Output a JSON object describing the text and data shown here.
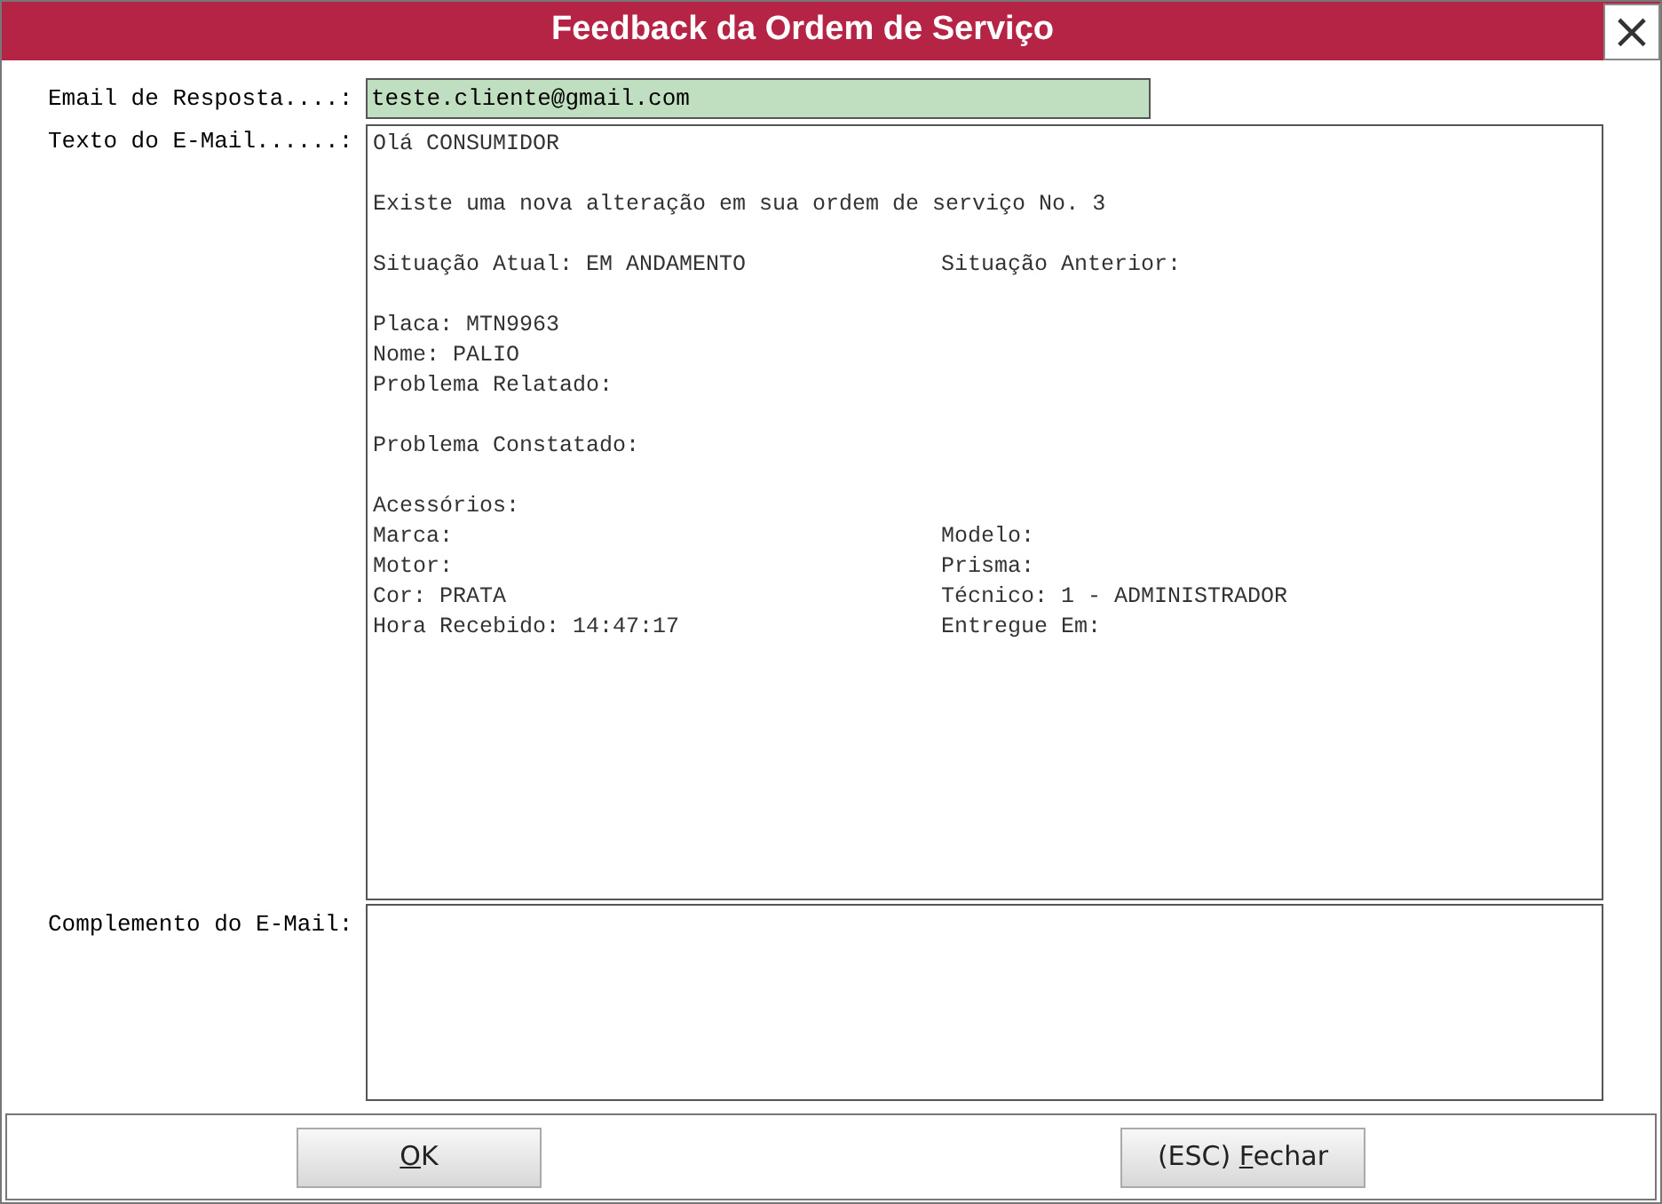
{
  "window": {
    "title": "Feedback da Ordem de Serviço",
    "close": "×"
  },
  "email": {
    "label": "Email de Resposta....:",
    "value": "teste.cliente@gmail.com"
  },
  "body": {
    "label": "Texto do E-Mail......:",
    "lines": [
      {
        "kind": "line",
        "left": "Olá CONSUMIDOR"
      },
      {
        "kind": "spaced",
        "left": "Existe uma nova alteração em sua ordem de serviço No. 3"
      },
      {
        "kind": "spaced",
        "left": "Situação Atual: EM ANDAMENTO",
        "right": "Situação Anterior:"
      },
      {
        "kind": "spaced",
        "left": "Placa: MTN9963"
      },
      {
        "kind": "line",
        "left": "Nome: PALIO"
      },
      {
        "kind": "line",
        "left": "Problema Relatado:"
      },
      {
        "kind": "spaced",
        "left": "Problema Constatado:"
      },
      {
        "kind": "spaced",
        "left": "Acessórios:"
      },
      {
        "kind": "line",
        "left": "Marca:",
        "right": "Modelo:"
      },
      {
        "kind": "line",
        "left": "Motor:",
        "right": "Prisma:"
      },
      {
        "kind": "line",
        "left": "Cor: PRATA",
        "right": "Técnico: 1 - ADMINISTRADOR"
      },
      {
        "kind": "line",
        "left": "Hora Recebido: 14:47:17",
        "right": "Entregue Em:"
      }
    ]
  },
  "complement": {
    "label": "Complemento do E-Mail:"
  },
  "buttons": [
    {
      "key": "O",
      "after": "K"
    },
    {
      "before": "(ESC) ",
      "key": "F",
      "after": "echar"
    }
  ]
}
